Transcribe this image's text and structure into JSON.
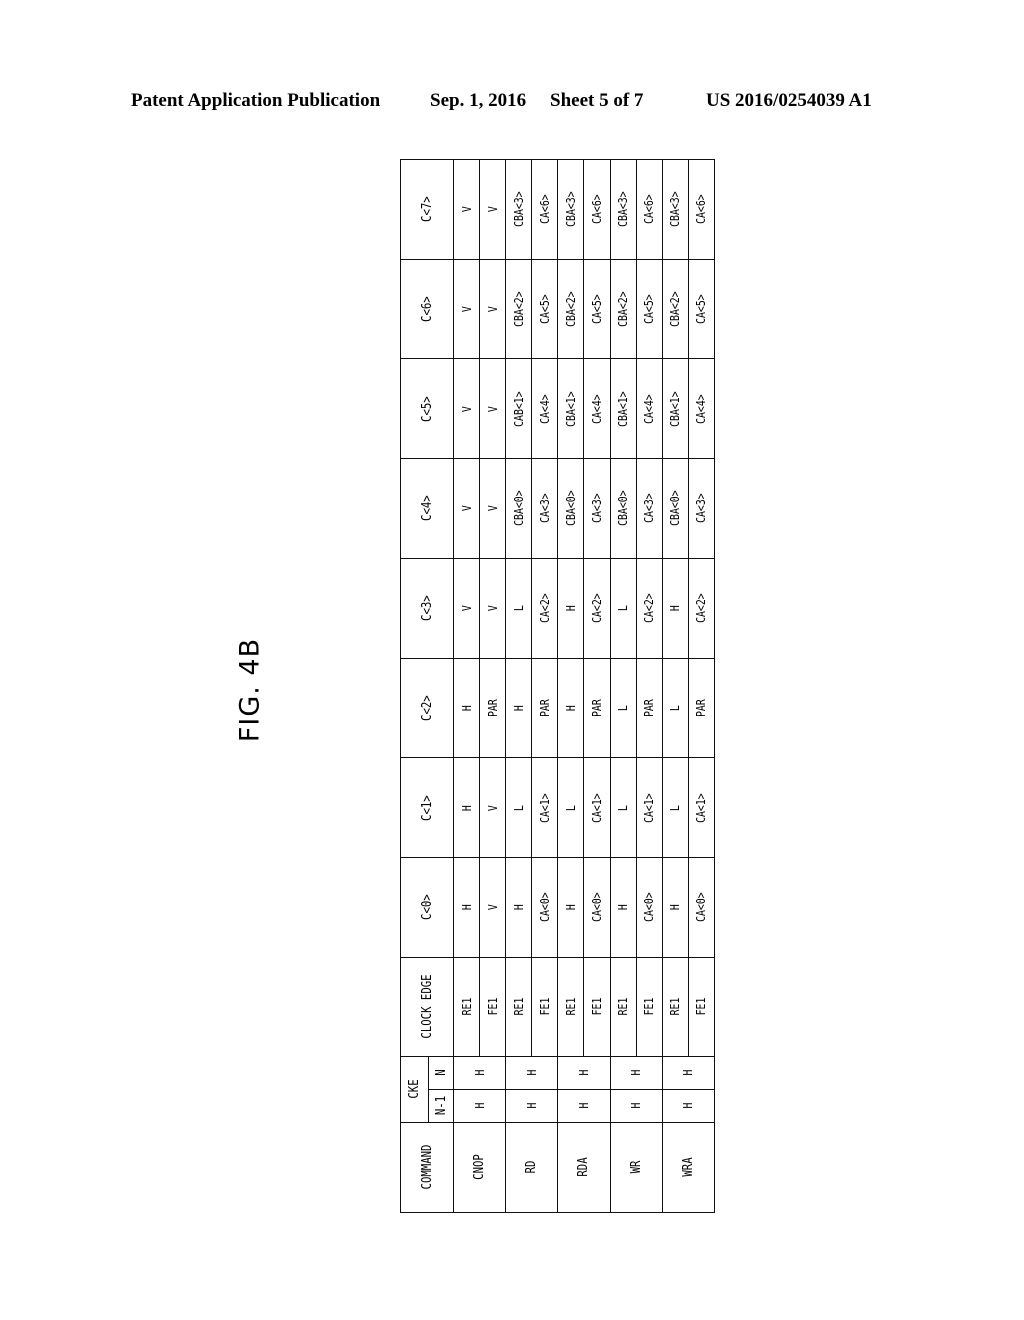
{
  "page_header": {
    "publication": "Patent Application Publication",
    "date": "Sep. 1, 2016",
    "sheet": "Sheet 5 of 7",
    "number": "US 2016/0254039 A1"
  },
  "figure_label": "FIG. 4B",
  "table": {
    "headers": {
      "command": "COMMAND",
      "cke": "CKE",
      "cke_n1": "N-1",
      "cke_n": "N",
      "clock_edge": "CLOCK EDGE",
      "c0": "C<0>",
      "c1": "C<1>",
      "c2": "C<2>",
      "c3": "C<3>",
      "c4": "C<4>",
      "c5": "C<5>",
      "c6": "C<6>",
      "c7": "C<7>"
    },
    "rows": [
      {
        "command": "CNOP",
        "cke_n1": "H",
        "cke_n": "H",
        "re": {
          "edge": "RE1",
          "c": [
            "H",
            "H",
            "H",
            "V",
            "V",
            "V",
            "V",
            "V"
          ]
        },
        "fe": {
          "edge": "FE1",
          "c": [
            "V",
            "V",
            "PAR",
            "V",
            "V",
            "V",
            "V",
            "V"
          ]
        }
      },
      {
        "command": "RD",
        "cke_n1": "H",
        "cke_n": "H",
        "re": {
          "edge": "RE1",
          "c": [
            "H",
            "L",
            "H",
            "L",
            "CBA<0>",
            "CAB<1>",
            "CBA<2>",
            "CBA<3>"
          ]
        },
        "fe": {
          "edge": "FE1",
          "c": [
            "CA<0>",
            "CA<1>",
            "PAR",
            "CA<2>",
            "CA<3>",
            "CA<4>",
            "CA<5>",
            "CA<6>"
          ]
        }
      },
      {
        "command": "RDA",
        "cke_n1": "H",
        "cke_n": "H",
        "re": {
          "edge": "RE1",
          "c": [
            "H",
            "L",
            "H",
            "H",
            "CBA<0>",
            "CBA<1>",
            "CBA<2>",
            "CBA<3>"
          ]
        },
        "fe": {
          "edge": "FE1",
          "c": [
            "CA<0>",
            "CA<1>",
            "PAR",
            "CA<2>",
            "CA<3>",
            "CA<4>",
            "CA<5>",
            "CA<6>"
          ]
        }
      },
      {
        "command": "WR",
        "cke_n1": "H",
        "cke_n": "H",
        "re": {
          "edge": "RE1",
          "c": [
            "H",
            "L",
            "L",
            "L",
            "CBA<0>",
            "CBA<1>",
            "CBA<2>",
            "CBA<3>"
          ]
        },
        "fe": {
          "edge": "FE1",
          "c": [
            "CA<0>",
            "CA<1>",
            "PAR",
            "CA<2>",
            "CA<3>",
            "CA<4>",
            "CA<5>",
            "CA<6>"
          ]
        }
      },
      {
        "command": "WRA",
        "cke_n1": "H",
        "cke_n": "H",
        "re": {
          "edge": "RE1",
          "c": [
            "H",
            "L",
            "L",
            "H",
            "CBA<0>",
            "CBA<1>",
            "CBA<2>",
            "CBA<3>"
          ]
        },
        "fe": {
          "edge": "FE1",
          "c": [
            "CA<0>",
            "CA<1>",
            "PAR",
            "CA<2>",
            "CA<3>",
            "CA<4>",
            "CA<5>",
            "CA<6>"
          ]
        }
      }
    ]
  }
}
